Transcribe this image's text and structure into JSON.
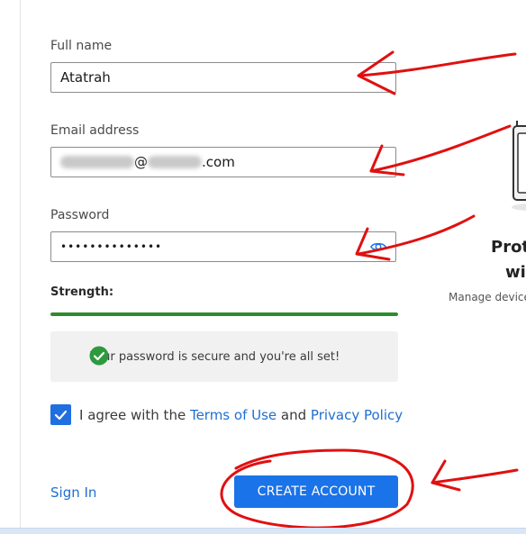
{
  "form": {
    "full_name": {
      "label": "Full name",
      "value": "Atatrah"
    },
    "email": {
      "label": "Email address",
      "at_sign": "@",
      "suffix": ".com"
    },
    "password": {
      "label": "Password",
      "value": "••••••••••••••"
    },
    "strength": {
      "label": "Strength:",
      "level": 1.0,
      "color": "#2e8b2e"
    },
    "notice": {
      "text": "Your password is secure and you're all set!"
    },
    "agree": {
      "checked": true,
      "prefix": "I agree with the ",
      "terms": "Terms of Use",
      "middle": " and ",
      "privacy": "Privacy Policy"
    },
    "sign_in": "Sign In",
    "create_account": "CREATE ACCOUNT"
  },
  "right_panel": {
    "title_line1": "Prot",
    "title_line2": "wit",
    "subtitle": "Manage device"
  },
  "colors": {
    "accent": "#1a73e8",
    "link": "#1f6fd1",
    "annotation": "#e01010"
  }
}
